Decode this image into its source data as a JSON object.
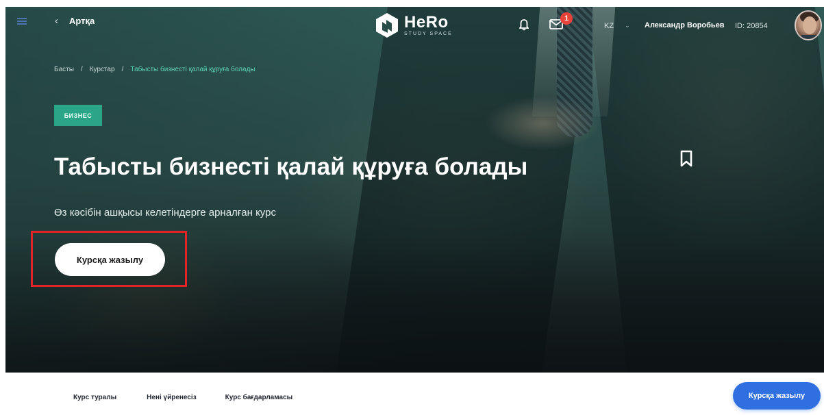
{
  "header": {
    "back_label": "Артқа",
    "logo_text": "HeRo",
    "logo_subtitle": "STUDY SPACE",
    "mail_badge_count": "1",
    "language": "KZ",
    "user_name": "Александр Воробьев",
    "user_id": "ID: 20854",
    "icons": [
      "menu-icon",
      "chevron-left-icon",
      "bell-icon",
      "mail-icon",
      "chevron-down-icon",
      "avatar"
    ]
  },
  "breadcrumb": {
    "items": [
      "Басты",
      "Курстар",
      "Табысты бизнесті қалай құруға болады"
    ],
    "separator": "/"
  },
  "course": {
    "category_badge": "БИЗНЕС",
    "title": "Табысты бизнесті қалай құруға болады",
    "subtitle": "Өз кәсібін ашқысы келетіндерге арналған курс",
    "enroll_label": "Курсқа жазылу",
    "bookmark_icon": "bookmark-icon"
  },
  "tabs": {
    "items": [
      "Курс туралы",
      "Нені үйренесіз",
      "Курс бағдарламасы"
    ]
  },
  "bottom_cta": {
    "label": "Курсқа жазылу"
  },
  "colors": {
    "accent_green": "#2aa588",
    "breadcrumb_active": "#5fd3b5",
    "cta_blue": "#2f6fe0",
    "badge_red": "#e8423b",
    "highlight_red": "#e3232a"
  }
}
